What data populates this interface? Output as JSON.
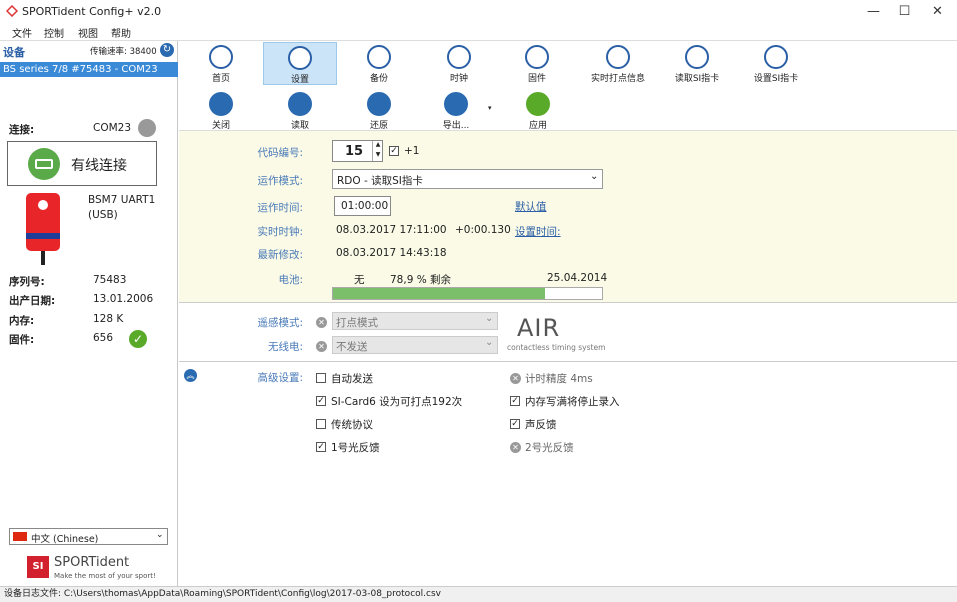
{
  "window": {
    "title": "SPORTident Config+ v2.0",
    "minimize": "—",
    "maximize": "☐",
    "close": "✕"
  },
  "menu": [
    "文件",
    "控制",
    "视图",
    "帮助"
  ],
  "left": {
    "devices_label": "设备",
    "baud_label": "传输速率: 38400",
    "selected_device": "BS series 7/8 #75483 - COM23",
    "connection_label": "连接:",
    "connection_port": "COM23",
    "wired_button": "有线连接",
    "device_model": "BSM7 UART1",
    "device_interface": "(USB)",
    "serial_label": "序列号:",
    "serial_value": "75483",
    "date_label": "出产日期:",
    "date_value": "13.01.2006",
    "memory_label": "内存:",
    "memory_value": "128 K",
    "firmware_label": "固件:",
    "firmware_value": "656",
    "language": "中文 (Chinese)",
    "logo_text": "SPORTident",
    "logo_tagline": "Make the most of your sport!"
  },
  "toolbar": {
    "row1": [
      "首页",
      "设置",
      "备份",
      "时钟",
      "固件",
      "实时打点信息",
      "读取SI指卡",
      "设置SI指卡"
    ],
    "row2": [
      "关闭",
      "读取",
      "还原",
      "导出...",
      "应用"
    ]
  },
  "settings": {
    "code_label": "代码编号:",
    "code_value": "15",
    "plus_one": "+1",
    "mode_label": "运作模式:",
    "mode_value": "RDO - 读取SI指卡",
    "optime_label": "运作时间:",
    "optime_value": "01:00:00",
    "default_link": "默认值",
    "clock_label": "实时时钟:",
    "clock_value": "08.03.2017 17:11:00",
    "clock_offset": "+0:00.130",
    "set_time_link": "设置时间:",
    "lastmod_label": "最新修改:",
    "lastmod_value": "08.03.2017 14:43:18",
    "battery_label": "电池:",
    "battery_none": "无",
    "battery_pct_text": "78,9 % 剩余",
    "battery_date": "25.04.2014",
    "battery_fraction": 0.789
  },
  "remote": {
    "remote_label": "遥感模式:",
    "remote_value": "打点模式",
    "radio_label": "无线电:",
    "radio_value": "不发送",
    "air_logo": "AIR",
    "air_tagline": "contactless timing system"
  },
  "advanced": {
    "label": "高级设置:",
    "items": [
      {
        "text": "自动发送",
        "state": "unchecked"
      },
      {
        "text": "SI-Card6 设为可打点192次",
        "state": "checked"
      },
      {
        "text": "传统协议",
        "state": "unchecked"
      },
      {
        "text": "1号光反馈",
        "state": "checked"
      },
      {
        "text": "计时精度 4ms",
        "state": "disabled"
      },
      {
        "text": "内存写满将停止录入",
        "state": "checked"
      },
      {
        "text": "声反馈",
        "state": "checked"
      },
      {
        "text": "2号光反馈",
        "state": "disabled"
      }
    ]
  },
  "status": "设备日志文件: C:\\Users\\thomas\\AppData\\Roaming\\SPORTident\\Config\\log\\2017-03-08_protocol.csv",
  "colors": {
    "selection": "#3a8ad8",
    "yellow_panel": "#fafae6",
    "battery_fill": "#7cbf6a",
    "label_blue": "#4a7ab8"
  }
}
